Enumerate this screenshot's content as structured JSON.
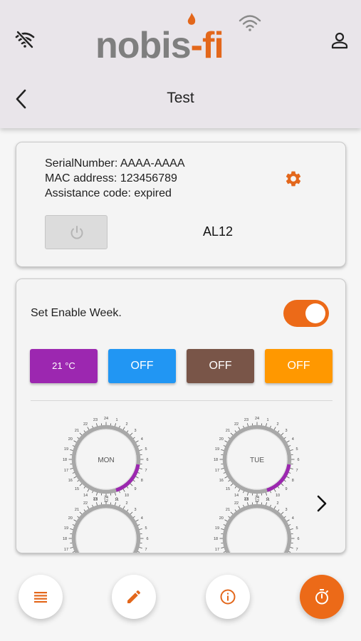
{
  "header": {
    "title": "Test",
    "logo": {
      "primary": "nobis",
      "separator": "-",
      "secondary": "fi"
    }
  },
  "device": {
    "serial": "SerialNumber: AAAA-AAAA",
    "mac": "MAC address: 123456789",
    "assistance": "Assistance code: expired",
    "name": "AL12",
    "power_on": false
  },
  "schedule": {
    "enable_label": "Set Enable Week.",
    "enabled": true,
    "temps": [
      {
        "label": "21 °C",
        "color": "#9c27b0"
      },
      {
        "label": "OFF",
        "color": "#2196f3"
      },
      {
        "label": "OFF",
        "color": "#795548"
      },
      {
        "label": "OFF",
        "color": "#ff9800"
      }
    ],
    "days": [
      "MON",
      "TUE"
    ],
    "dial_hours": [
      "1",
      "2",
      "3",
      "4",
      "5",
      "6",
      "7",
      "8",
      "9",
      "10",
      "11",
      "12",
      "13",
      "14",
      "15",
      "16",
      "17",
      "18",
      "19",
      "20",
      "21",
      "22",
      "23",
      "24"
    ]
  },
  "icons": {
    "wifi": "wifi-off-icon",
    "user": "person-outline-icon",
    "back": "chevron-left-icon",
    "settings": "gear-icon",
    "power": "power-icon",
    "next": "chevron-right-icon",
    "nav": [
      "list-icon",
      "pencil-icon",
      "info-icon",
      "timer-icon"
    ]
  },
  "colors": {
    "accent": "#ec6a18",
    "header_bg": "#e9e5ea",
    "dial_active": "#9c27b0"
  }
}
